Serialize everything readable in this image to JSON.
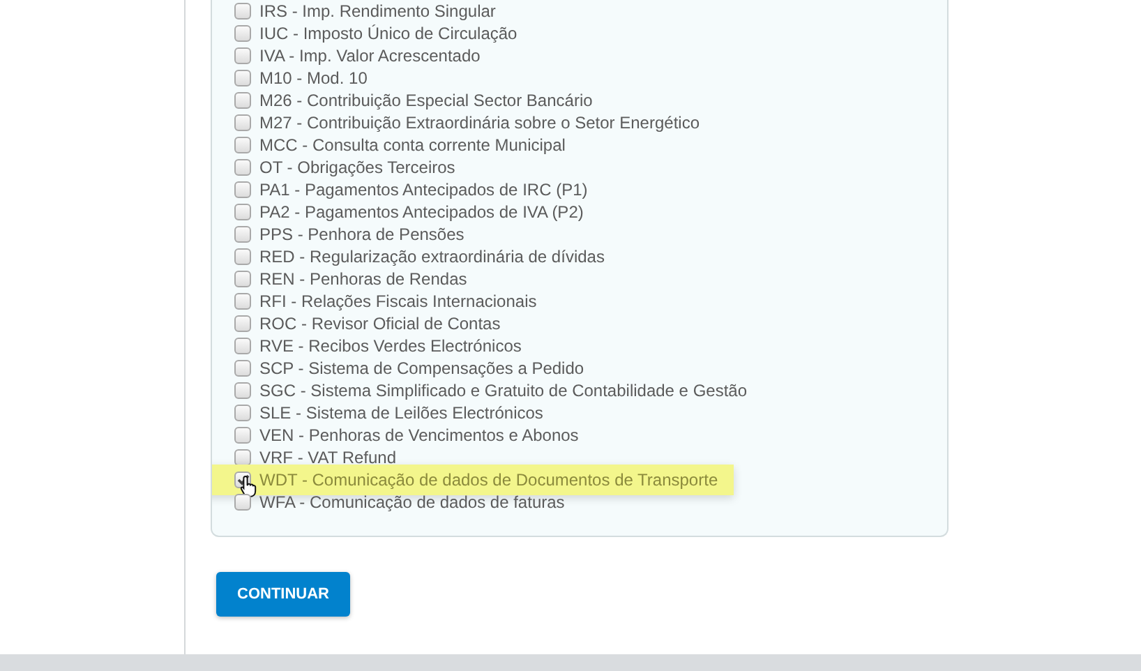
{
  "options": [
    {
      "label": "IRS - Imp. Rendimento Singular",
      "checked": false,
      "highlighted": false
    },
    {
      "label": "IUC - Imposto Único de Circulação",
      "checked": false,
      "highlighted": false
    },
    {
      "label": "IVA - Imp. Valor Acrescentado",
      "checked": false,
      "highlighted": false
    },
    {
      "label": "M10 - Mod. 10",
      "checked": false,
      "highlighted": false
    },
    {
      "label": "M26 - Contribuição Especial Sector Bancário",
      "checked": false,
      "highlighted": false
    },
    {
      "label": "M27 - Contribuição Extraordinária sobre o Setor Energético",
      "checked": false,
      "highlighted": false
    },
    {
      "label": "MCC - Consulta conta corrente Municipal",
      "checked": false,
      "highlighted": false
    },
    {
      "label": "OT - Obrigações Terceiros",
      "checked": false,
      "highlighted": false
    },
    {
      "label": "PA1 - Pagamentos Antecipados de IRC (P1)",
      "checked": false,
      "highlighted": false
    },
    {
      "label": "PA2 - Pagamentos Antecipados de IVA (P2)",
      "checked": false,
      "highlighted": false
    },
    {
      "label": "PPS - Penhora de Pensões",
      "checked": false,
      "highlighted": false
    },
    {
      "label": "RED - Regularização extraordinária de dívidas",
      "checked": false,
      "highlighted": false
    },
    {
      "label": "REN - Penhoras de Rendas",
      "checked": false,
      "highlighted": false
    },
    {
      "label": "RFI - Relações Fiscais Internacionais",
      "checked": false,
      "highlighted": false
    },
    {
      "label": "ROC - Revisor Oficial de Contas",
      "checked": false,
      "highlighted": false
    },
    {
      "label": "RVE - Recibos Verdes Electrónicos",
      "checked": false,
      "highlighted": false
    },
    {
      "label": "SCP - Sistema de Compensações a Pedido",
      "checked": false,
      "highlighted": false
    },
    {
      "label": "SGC - Sistema Simplificado e Gratuito de Contabilidade e Gestão",
      "checked": false,
      "highlighted": false
    },
    {
      "label": "SLE - Sistema de Leilões Electrónicos",
      "checked": false,
      "highlighted": false
    },
    {
      "label": "VEN - Penhoras de Vencimentos e Abonos",
      "checked": false,
      "highlighted": false
    },
    {
      "label": "VRF - VAT Refund",
      "checked": false,
      "highlighted": false
    },
    {
      "label": "WDT - Comunicação de dados de Documentos de Transporte",
      "checked": true,
      "highlighted": true
    },
    {
      "label": "WFA - Comunicação de dados de faturas",
      "checked": false,
      "highlighted": false
    }
  ],
  "continue_button": {
    "label": "CONTINUAR"
  }
}
